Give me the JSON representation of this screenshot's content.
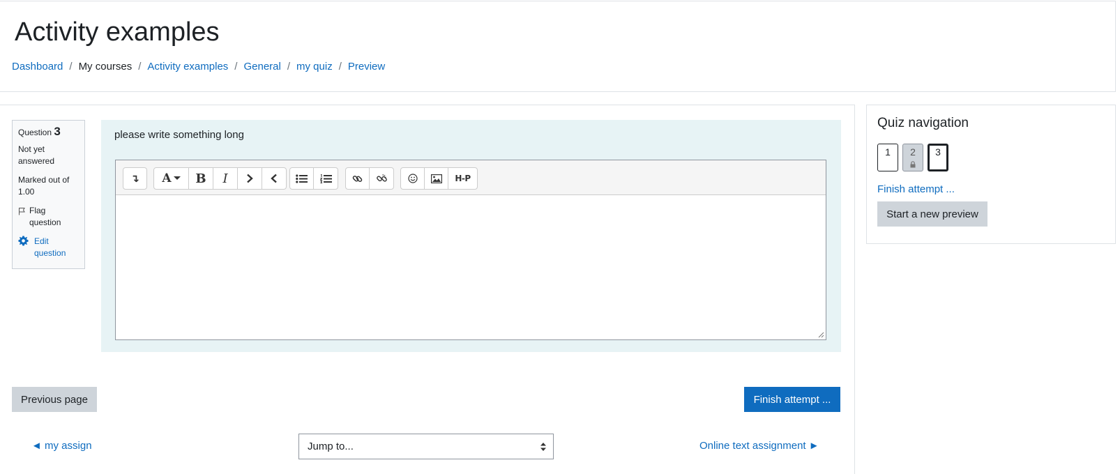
{
  "header": {
    "title": "Activity examples",
    "breadcrumb": {
      "dashboard": "Dashboard",
      "my_courses": "My courses",
      "activity_examples": "Activity examples",
      "general": "General",
      "my_quiz": "my quiz",
      "preview": "Preview",
      "separator": "/"
    }
  },
  "question_info": {
    "label": "Question",
    "number": "3",
    "state": "Not yet answered",
    "marked_out_of": "Marked out of 1.00",
    "flag_label": "Flag question",
    "edit_label": "Edit question"
  },
  "question": {
    "text": "please write something long",
    "editor_value": ""
  },
  "toolbar_icons": [
    "collapse-icon",
    "font-style-icon",
    "bold-icon",
    "italic-icon",
    "indent-icon",
    "outdent-icon",
    "unordered-list-icon",
    "ordered-list-icon",
    "link-icon",
    "unlink-icon",
    "emoji-icon",
    "image-icon",
    "h5p-icon"
  ],
  "toolbar_glyphs": {
    "collapse": "↴",
    "font": "A",
    "bold": "B",
    "italic": "I",
    "h5p": "H-P"
  },
  "buttons": {
    "previous_page": "Previous page",
    "finish_attempt": "Finish attempt ..."
  },
  "activity_nav": {
    "prev": "◄ my assign",
    "next": "Online text assignment ►",
    "jump_placeholder": "Jump to..."
  },
  "quiz_navigation": {
    "title": "Quiz navigation",
    "questions": [
      "1",
      "2",
      "3"
    ],
    "finish_link": "Finish attempt ...",
    "new_preview": "Start a new preview"
  },
  "colors": {
    "link": "#0f6cbf",
    "primary": "#0f6cbf",
    "secondary": "#ced4da",
    "question_bg": "#e7f3f5"
  }
}
